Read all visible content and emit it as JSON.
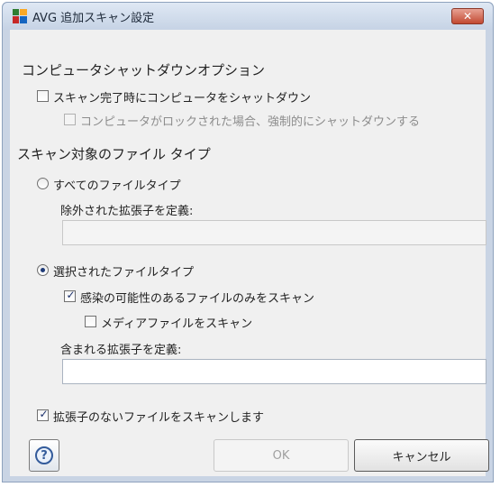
{
  "window": {
    "title": "AVG 追加スキャン設定",
    "close_glyph": "✕"
  },
  "shutdown": {
    "heading": "コンピュータシャットダウンオプション",
    "shutdown_on_complete": {
      "label": "スキャン完了時にコンピュータをシャットダウン",
      "checked": false
    },
    "force_if_locked": {
      "label": "コンピュータがロックされた場合、強制的にシャットダウンする",
      "checked": false,
      "enabled": false
    }
  },
  "file_types": {
    "heading": "スキャン対象のファイル タイプ",
    "all_types": {
      "label": "すべてのファイルタイプ",
      "selected": false
    },
    "exclude_ext_label": "除外された拡張子を定義:",
    "exclude_ext_value": "",
    "selected_types": {
      "label": "選択されたファイルタイプ",
      "selected": true
    },
    "infectable_only": {
      "label": "感染の可能性のあるファイルのみをスキャン",
      "checked": true
    },
    "media_files": {
      "label": "メディアファイルをスキャン",
      "checked": false
    },
    "include_ext_label": "含まれる拡張子を定義:",
    "include_ext_value": "",
    "no_extension": {
      "label": "拡張子のないファイルをスキャンします",
      "checked": true
    }
  },
  "buttons": {
    "help_glyph": "?",
    "ok": "OK",
    "cancel": "キャンセル"
  },
  "icons": {
    "app": "avg-logo-icon",
    "help": "help-icon",
    "check": "checkmark-icon"
  }
}
